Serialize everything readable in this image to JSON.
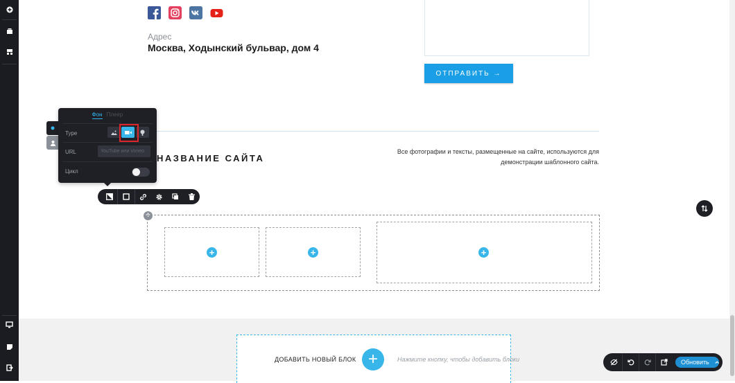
{
  "contact": {
    "address_label": "Адрес",
    "address_value": "Москва, Ходынский бульвар, дом 4",
    "send_button": "ОТПРАВИТЬ →"
  },
  "footer": {
    "site_name": "НАЗВАНИЕ САЙТА",
    "copyright": "Все фотографии и тексты, размещенные на сайте, используются для демонстрации шаблонного сайта."
  },
  "popup": {
    "tab_active": "Фон",
    "tab_inactive": "Плеер",
    "type_label": "Type",
    "url_label": "URL",
    "url_placeholder": "YouTube или Vimeo",
    "loop_label": "Цикл"
  },
  "add_block": {
    "label": "ДОБАВИТЬ НОВЫЙ БЛОК",
    "plus": "+",
    "hint": "Нажмите кнопку, чтобы добавить блоки"
  },
  "bottom_bar": {
    "update_label": "Обновить"
  },
  "colors": {
    "accent": "#38b6ea",
    "sidebar": "#1a1c22",
    "highlight": "#e0252b"
  }
}
